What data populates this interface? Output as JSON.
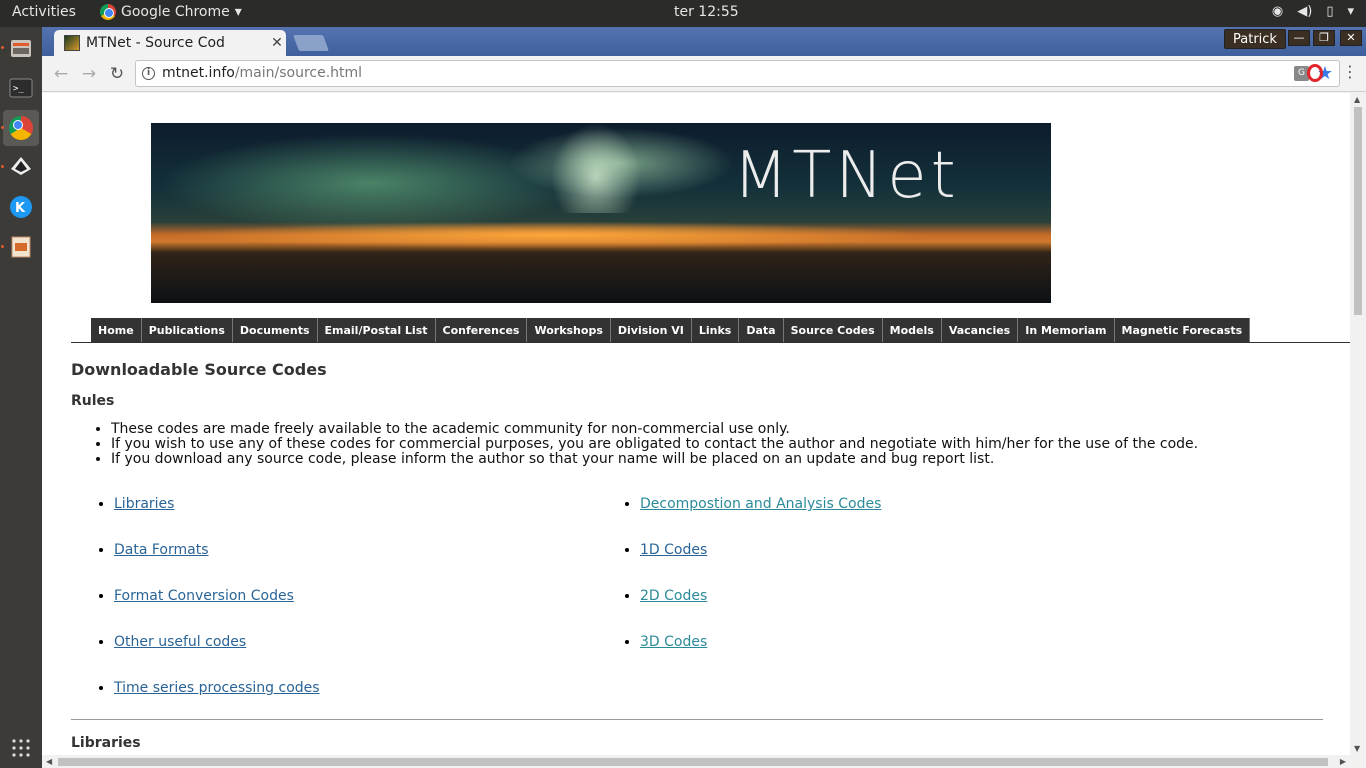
{
  "topbar": {
    "activities": "Activities",
    "app_name": "Google Chrome",
    "clock": "ter 12:55"
  },
  "browser": {
    "tab_title": "MTNet - Source Cod",
    "profile": "Patrick",
    "url_host": "mtnet.info",
    "url_path": "/main/source.html"
  },
  "page": {
    "banner_text": "MTNet",
    "nav": [
      "Home",
      "Publications",
      "Documents",
      "Email/Postal List",
      "Conferences",
      "Workshops",
      "Division VI",
      "Links",
      "Data",
      "Source Codes",
      "Models",
      "Vacancies",
      "In Memoriam",
      "Magnetic Forecasts"
    ],
    "heading": "Downloadable Source Codes",
    "rules_heading": "Rules",
    "rules": [
      "These codes are made freely available to the academic community for non-commercial use only.",
      "If you wish to use any of these codes for commercial purposes, you are obligated to contact the author and negotiate with him/her for the use of the code.",
      "If you download any source code, please inform the author so that your name will be placed on an update and bug report list."
    ],
    "links_left": [
      "Libraries",
      "Data Formats",
      "Format Conversion Codes",
      "Other useful codes",
      "Time series processing codes"
    ],
    "links_right": [
      "Decompostion and Analysis Codes",
      "1D Codes",
      "2D Codes",
      "3D Codes"
    ],
    "libraries_heading": "Libraries"
  }
}
